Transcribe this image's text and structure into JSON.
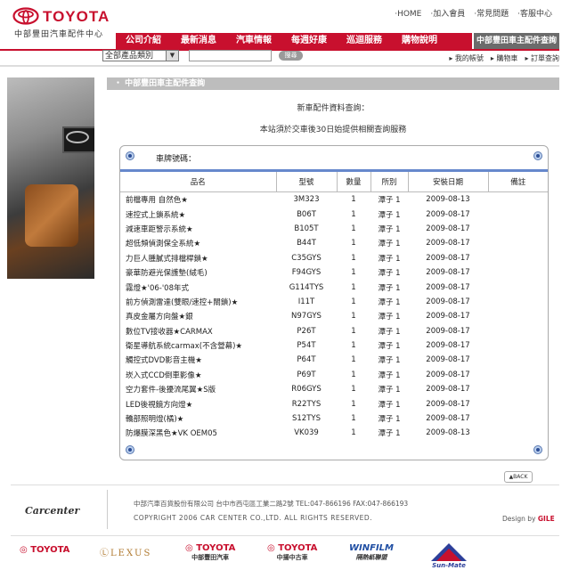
{
  "header": {
    "brand": "TOYOTA",
    "brand_sub": "中部豐田汽車配件中心",
    "top_links": [
      "‧HOME",
      "‧加入會員",
      "‧常見問題",
      "‧客服中心"
    ]
  },
  "nav": {
    "items": [
      "公司介紹",
      "最新消息",
      "汽車情報",
      "每週好康",
      "巡迴服務",
      "購物說明"
    ],
    "special": "中部豐田車主配件查詢"
  },
  "search": {
    "category_selected": "全部產品類別",
    "input_value": "",
    "button_label": "搜尋"
  },
  "right_links": [
    "▸ 我的帳號",
    "▸ 購物車",
    "▸ 訂單查詢"
  ],
  "content": {
    "title": "‧ 中部豐田車主配件查詢",
    "line1": "新車配件資料查詢：",
    "line2": "本站須於交車後30日始提供相關查詢服務",
    "plate_label": "車牌號碼："
  },
  "table": {
    "headers": [
      "品名",
      "型號",
      "數量",
      "所別",
      "安裝日期",
      "備註"
    ],
    "rows": [
      [
        "前檔專用 自然色★",
        "3M323",
        "1",
        "潭子 1",
        "2009-08-13",
        ""
      ],
      [
        "速控式上鎖系統★",
        "B06T",
        "1",
        "潭子 1",
        "2009-08-17",
        ""
      ],
      [
        "減速車距警示系統★",
        "B105T",
        "1",
        "潭子 1",
        "2009-08-17",
        ""
      ],
      [
        "超低頻偵測保全系統★",
        "B44T",
        "1",
        "潭子 1",
        "2009-08-17",
        ""
      ],
      [
        "力巨人腫膩式排檔桿鎖★",
        "C35GYS",
        "1",
        "潭子 1",
        "2009-08-17",
        ""
      ],
      [
        "豪華防避光保護墊(絨毛)",
        "F94GYS",
        "1",
        "潭子 1",
        "2009-08-17",
        ""
      ],
      [
        "霧燈★'06-'08年式",
        "G114TYS",
        "1",
        "潭子 1",
        "2009-08-17",
        ""
      ],
      [
        "前方偵測雷達(雙眼/速控+閘鎖)★",
        "I11T",
        "1",
        "潭子 1",
        "2009-08-17",
        ""
      ],
      [
        "真皮金屬方向盤★銀",
        "N97GYS",
        "1",
        "潭子 1",
        "2009-08-17",
        ""
      ],
      [
        "數位TV接收器★CARMAX",
        "P26T",
        "1",
        "潭子 1",
        "2009-08-17",
        ""
      ],
      [
        "衛星導航系統carmax(不含營幕)★",
        "P54T",
        "1",
        "潭子 1",
        "2009-08-17",
        ""
      ],
      [
        "觸控式DVD影音主機★",
        "P64T",
        "1",
        "潭子 1",
        "2009-08-17",
        ""
      ],
      [
        "崁入式CCD倒車影像★",
        "P69T",
        "1",
        "潭子 1",
        "2009-08-17",
        ""
      ],
      [
        "空力套件-後擾流尾翼★S版",
        "R06GYS",
        "1",
        "潭子 1",
        "2009-08-17",
        ""
      ],
      [
        "LED後視鏡方向燈★",
        "R22TYS",
        "1",
        "潭子 1",
        "2009-08-17",
        ""
      ],
      [
        "轎部照明燈(橘)★",
        "S12TYS",
        "1",
        "潭子 1",
        "2009-08-17",
        ""
      ],
      [
        "防爆膜深黑色★VK OEM05",
        "VK039",
        "1",
        "潭子 1",
        "2009-08-13",
        ""
      ]
    ]
  },
  "back_label": "▲BACK",
  "footer": {
    "logo": "Carcenter",
    "address": "中部汽車百貨股份有限公司  台中市西屯區工業二路2號     TEL:047-866196    FAX:047-866193",
    "copyright": "COPYRIGHT 2006 CAR CENTER CO.,LTD. ALL RIGHTS RESERVED.",
    "design_prefix": "Design by ",
    "design_name": "GILE"
  },
  "brands": [
    {
      "name": "TOYOTA",
      "sub": ""
    },
    {
      "name": "LEXUS",
      "sub": ""
    },
    {
      "name": "TOYOTA",
      "sub": "中部豐田汽車"
    },
    {
      "name": "TOYOTA",
      "sub": "中揚中古車"
    },
    {
      "name": "WINFILM",
      "sub": "隔熱紙聯盟"
    },
    {
      "name": "Sun-Mate",
      "sub": ""
    }
  ],
  "colors": {
    "accent": "#c8102e",
    "nav_special": "#6b6b6b",
    "table_rule": "#6688cc"
  }
}
